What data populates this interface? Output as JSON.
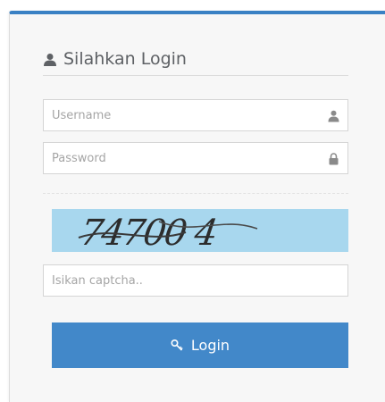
{
  "login": {
    "title": "Silahkan Login",
    "username_placeholder": "Username",
    "password_placeholder": "Password",
    "captcha_value": "74700 4",
    "captcha_placeholder": "Isikan captcha..",
    "button_label": "Login"
  },
  "icons": {
    "title": "user-icon",
    "username": "user-icon",
    "password": "lock-icon",
    "button": "key-icon"
  },
  "colors": {
    "accent": "#4288c9",
    "captcha_bg": "#a8d7ee"
  }
}
